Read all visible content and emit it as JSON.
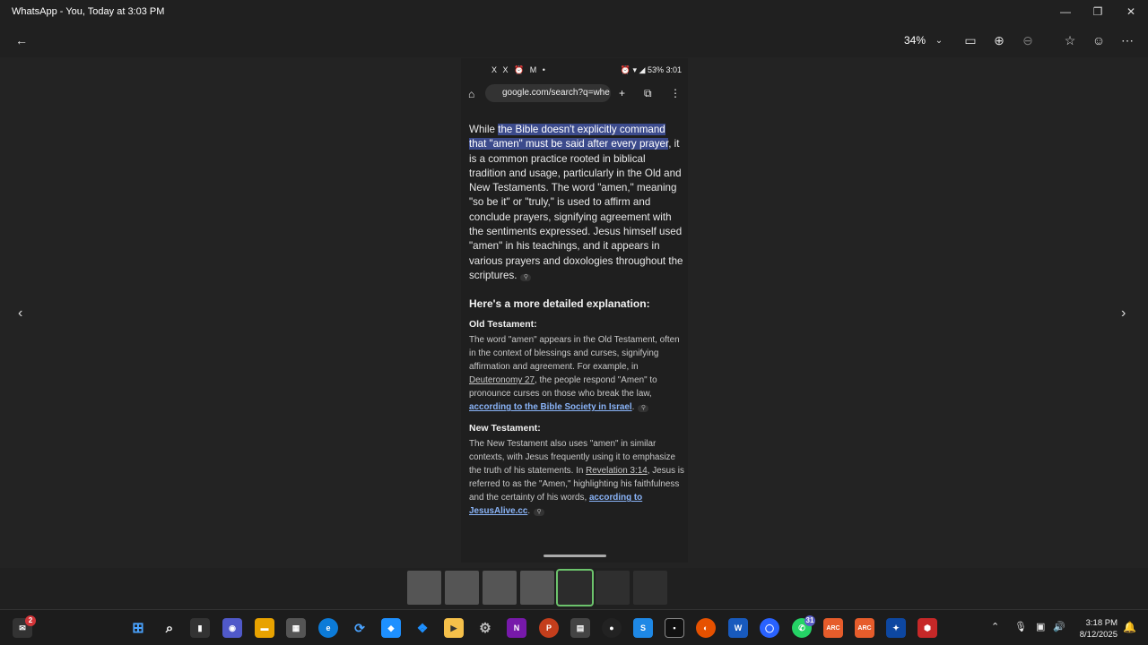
{
  "window": {
    "title": "WhatsApp - You, Today at 3:03 PM"
  },
  "toolbar": {
    "zoom": "34%"
  },
  "phone": {
    "status_left": "X X ⏰ M •",
    "status_right": "⏰ ▾ ◢ 53% 3:01",
    "url": "google.com/search?q=whe",
    "intro_pre": "While ",
    "intro_hl": "the Bible doesn't explicitly command that \"amen\" must be said after every prayer",
    "intro_post": ", it is a common practice rooted in biblical tradition and usage, particularly in the Old and New Testaments. The word \"amen,\" meaning \"so be it\" or \"truly,\" is used to affirm and conclude prayers, signifying agreement with the sentiments expressed. Jesus himself used \"amen\" in his teachings, and it appears in various prayers and doxologies throughout the scriptures.",
    "subheading": "Here's a more detailed explanation:",
    "ot_heading": "Old Testament:",
    "ot_pre": "The word \"amen\" appears in the Old Testament, often in the context of blessings and curses, signifying affirmation and agreement. For example, in ",
    "ot_ref": "Deuteronomy 27",
    "ot_mid": ", the people respond \"Amen\" to pronounce curses on those who break the law, ",
    "ot_link": "according to the Bible Society in Israel",
    "nt_heading": "New Testament:",
    "nt_pre": "The New Testament also uses \"amen\" in similar contexts, with Jesus frequently using it to emphasize the truth of his statements. In ",
    "nt_ref": "Revelation 3:14",
    "nt_mid": ", Jesus is referred to as the \"Amen,\" highlighting his faithfulness and the certainty of his words, ",
    "nt_link": "according to JesusAlive.cc"
  },
  "taskbar": {
    "clock_time": "3:18 PM",
    "clock_date": "8/12/2025",
    "whatsapp_badge": "31",
    "notif_badge": "2"
  }
}
